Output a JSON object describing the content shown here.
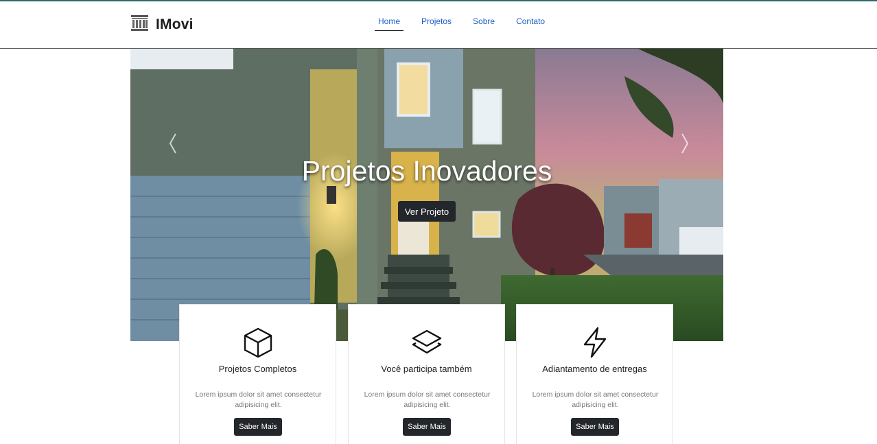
{
  "brand": {
    "name": "IMovi",
    "icon": "building-columns-icon"
  },
  "nav": {
    "items": [
      {
        "label": "Home",
        "active": true
      },
      {
        "label": "Projetos",
        "active": false
      },
      {
        "label": "Sobre",
        "active": false
      },
      {
        "label": "Contato",
        "active": false
      }
    ]
  },
  "hero": {
    "title": "Projetos Inovadores",
    "button": "Ver Projeto",
    "prev_icon": "chevron-left-icon",
    "next_icon": "chevron-right-icon"
  },
  "features": [
    {
      "icon": "cube-icon",
      "title": "Projetos Completos",
      "text": "Lorem ipsum dolor sit amet consectetur adipisicing elit.",
      "button": "Saber Mais"
    },
    {
      "icon": "layers-icon",
      "title": "Você participa também",
      "text": "Lorem ipsum dolor sit amet consectetur adipisicing elit.",
      "button": "Saber Mais"
    },
    {
      "icon": "lightning-icon",
      "title": "Adiantamento de entregas",
      "text": "Lorem ipsum dolor sit amet consectetur adipisicing elit.",
      "button": "Saber Mais"
    }
  ],
  "colors": {
    "link": "#1d5fc9",
    "dark_button": "#23262b",
    "top_accent": "#2b6a6b"
  }
}
